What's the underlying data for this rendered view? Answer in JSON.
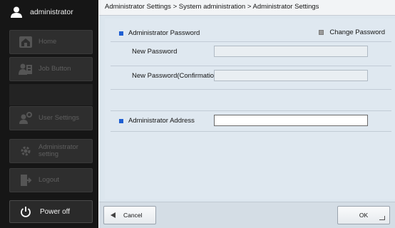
{
  "sidebar": {
    "user_name": "administrator",
    "items": [
      {
        "label": "Home",
        "icon": "home-icon"
      },
      {
        "label": "Job Button",
        "icon": "job-button-icon"
      },
      {
        "label": "User Settings",
        "icon": "user-settings-icon"
      },
      {
        "label": "Administrator\nsetting",
        "icon": "gear-icon"
      },
      {
        "label": "Logout",
        "icon": "logout-icon"
      }
    ],
    "power_off_label": "Power off"
  },
  "breadcrumb": "Administrator Settings > System administration > Administrator Settings",
  "form": {
    "password_section_title": "Administrator Password",
    "change_password_label": "Change Password",
    "new_password_label": "New Password",
    "new_password_value": "",
    "confirm_password_label": "New Password(Confirmation)",
    "confirm_password_value": "",
    "address_section_title": "Administrator Address",
    "address_value": ""
  },
  "footer": {
    "cancel_label": "Cancel",
    "ok_label": "OK"
  },
  "colors": {
    "accent": "#1f5fd2",
    "sidebar_bg": "#161616",
    "panel_bg": "#dfe8f0"
  }
}
